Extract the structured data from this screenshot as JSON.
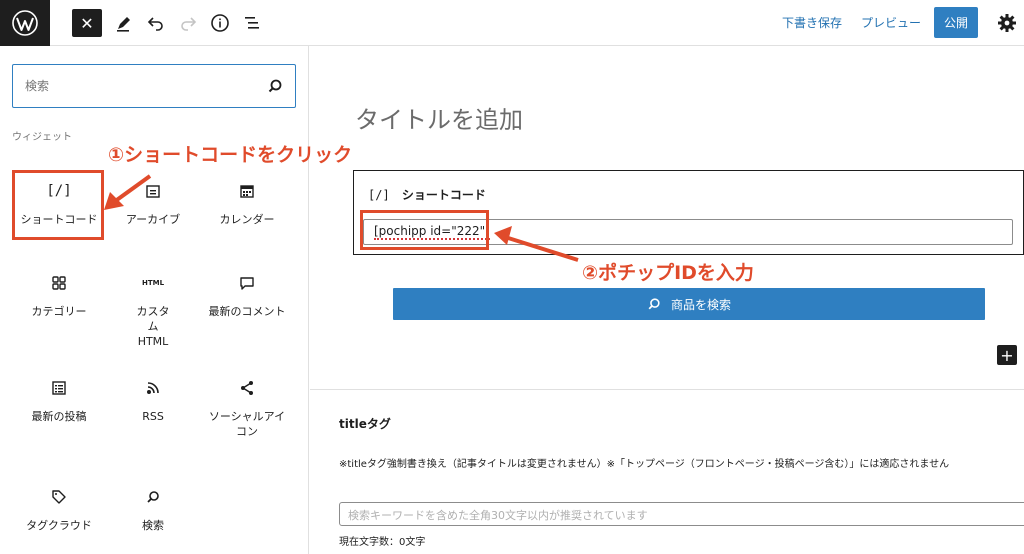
{
  "topbar": {
    "save_draft": "下書き保存",
    "preview": "プレビュー",
    "publish": "公開"
  },
  "sidebar": {
    "search_placeholder": "検索",
    "category": "ウィジェット",
    "items": [
      {
        "label": "ショートコード",
        "icon": "shortcode-icon"
      },
      {
        "label": "アーカイブ",
        "icon": "archive-icon"
      },
      {
        "label": "カレンダー",
        "icon": "calendar-icon"
      },
      {
        "label": "カテゴリー",
        "icon": "categories-icon"
      },
      {
        "label": "カスタム HTML",
        "icon": "html-icon",
        "icon_text": "HTML"
      },
      {
        "label": "最新のコメント",
        "icon": "comment-icon"
      },
      {
        "label": "最新の投稿",
        "icon": "latest-posts-icon"
      },
      {
        "label": "RSS",
        "icon": "rss-icon"
      },
      {
        "label": "ソーシャルアイコン",
        "icon": "share-icon"
      },
      {
        "label": "タグクラウド",
        "icon": "tag-icon"
      },
      {
        "label": "検索",
        "icon": "search-icon"
      }
    ]
  },
  "editor": {
    "title_placeholder": "タイトルを追加",
    "shortcode_block": {
      "icon_text": "[/]",
      "title": "ショートコード",
      "value": "[pochipp id=\"222\"]"
    },
    "search_product_button": "商品を検索"
  },
  "meta": {
    "title": "titleタグ",
    "description": "※titleタグ強制書き換え（記事タイトルは変更されません）※「トップページ（フロントページ・投稿ページ含む）」には適応されません",
    "input_placeholder": "検索キーワードを含めた全角30文字以内が推奨されています",
    "char_count": "現在文字数：0文字"
  },
  "annotations": {
    "step1": "①ショートコードをクリック",
    "step2": "②ポチップIDを入力"
  },
  "colors": {
    "accent": "#2f7fc1",
    "annotation": "#e04b2b",
    "dark": "#1e1e1e"
  }
}
